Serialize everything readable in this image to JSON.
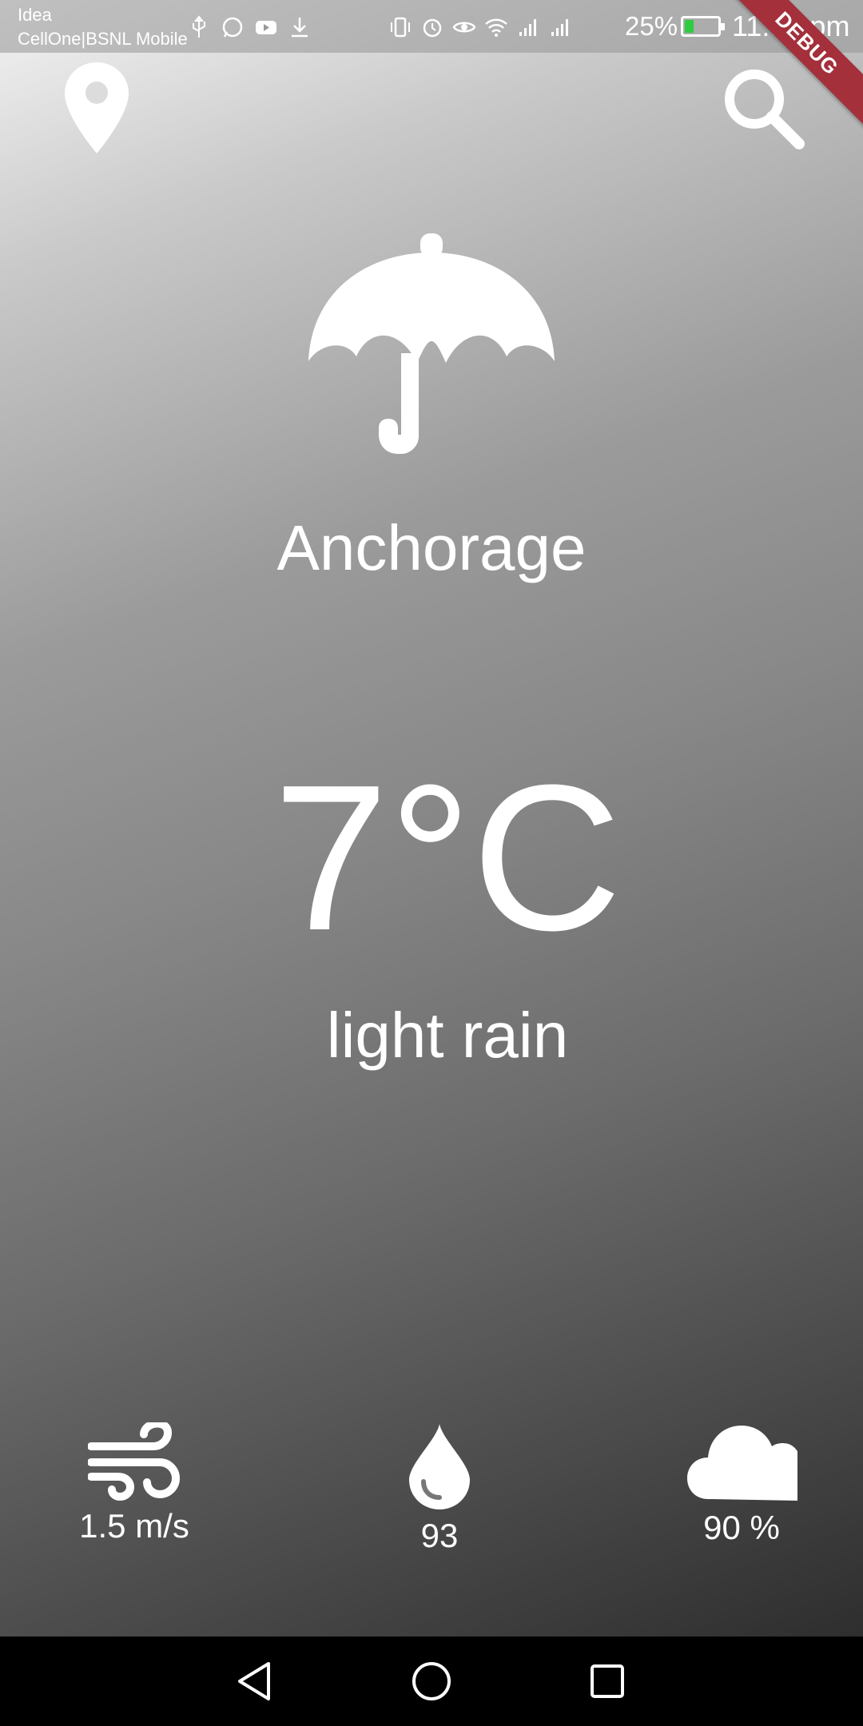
{
  "status_bar": {
    "carrier_1": "Idea",
    "carrier_2": "CellOne|BSNL Mobile",
    "battery": "25%",
    "battery_level": 0.25,
    "time": "11:08 pm",
    "left_icons": [
      "usb-icon",
      "whatsapp-icon",
      "youtube-icon",
      "download-icon"
    ],
    "right_icons": [
      "vibrate-icon",
      "alarm-icon",
      "eye-icon",
      "wifi-icon",
      "signal-icon",
      "signal-icon"
    ]
  },
  "debug_banner": "DEBUG",
  "top_bar": {
    "left_icon": "location-pin-icon",
    "right_icon": "search-icon"
  },
  "weather": {
    "icon": "umbrella-icon",
    "city": "Anchorage",
    "temperature": "7°C",
    "description": "light rain"
  },
  "stats": {
    "wind": {
      "icon": "wind-icon",
      "value": "1.5 m/s"
    },
    "humidity": {
      "icon": "water-drop-icon",
      "value": "93"
    },
    "clouds": {
      "icon": "cloud-icon",
      "value": "90 %"
    }
  },
  "nav_bar": [
    "back-icon",
    "home-icon",
    "recents-icon"
  ],
  "colors": {
    "gradient_top": "#f4f4f4",
    "gradient_bottom": "#2e2e2e",
    "debug_banner": "#a3303a",
    "battery_fill": "#2ecc40"
  }
}
